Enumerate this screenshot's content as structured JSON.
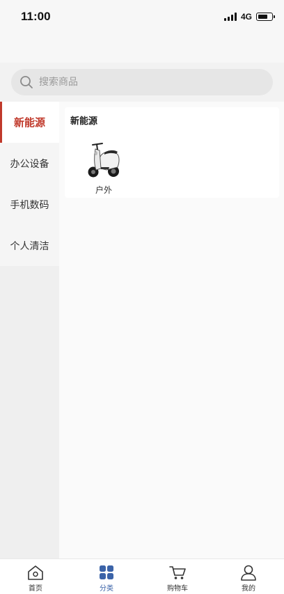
{
  "status_bar": {
    "time": "11:00",
    "network": "4G",
    "battery_level": 0.75
  },
  "search": {
    "placeholder": "搜索商品"
  },
  "sidebar": {
    "items": [
      {
        "label": "新能源",
        "active": true
      },
      {
        "label": "办公设备",
        "active": false
      },
      {
        "label": "手机数码",
        "active": false
      },
      {
        "label": "个人清洁",
        "active": false
      }
    ]
  },
  "content": {
    "section_title": "新能源",
    "products": [
      {
        "name": "户外",
        "icon": "scooter-image"
      }
    ]
  },
  "tabbar": {
    "items": [
      {
        "label": "首页",
        "icon": "home-icon"
      },
      {
        "label": "分类",
        "icon": "category-icon",
        "active": true
      },
      {
        "label": "购物车",
        "icon": "cart-icon"
      },
      {
        "label": "我的",
        "icon": "profile-icon"
      }
    ]
  },
  "colors": {
    "accent_red": "#c0392b",
    "active_tab_blue": "#3b63a8"
  }
}
